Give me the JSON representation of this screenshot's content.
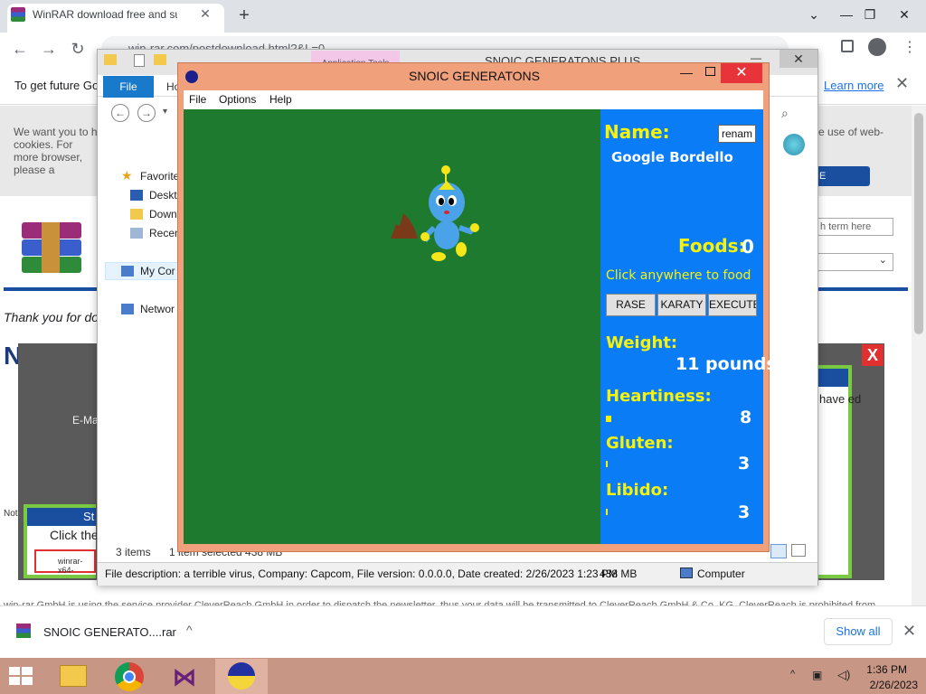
{
  "browser": {
    "tab_title": "WinRAR download free and supp",
    "tab_close": "✕",
    "new_tab": "+",
    "url": "win-rar.com/postdownload.html?&L=0",
    "controls": {
      "chevron": "⌄",
      "minimize": "—",
      "restore": "❐",
      "close": "✕"
    },
    "nav": {
      "back": "←",
      "forward": "→",
      "reload": "↻"
    },
    "infobar": {
      "text": "To get future Go",
      "help": "?",
      "learn_more": "Learn more",
      "close": "✕"
    }
  },
  "page": {
    "cookie_text": "We want you to h cookies. For more browser, please a",
    "cookie_right": "e use of web-",
    "cookie_button": "E",
    "search_placeholder": "h term here",
    "select_arrow": "⌄",
    "thanks": "Thank you for do",
    "heading": "Now ge",
    "email_label": "E-Ma",
    "overlay_close": "X",
    "popup_right_text": "have ed",
    "popup_left_header": "St",
    "popup_left_text": "Click the",
    "download_file": "winrar-x64-",
    "note": "Not",
    "footer": "win-rar GmbH is using the service provider CleverReach GmbH in order to dispatch the newsletter, thus your data will be transmitted to CleverReach GmbH & Co. KG. CleverReach is prohibited from"
  },
  "explorer": {
    "title": "SNOIC GENERATONS PLUS",
    "app_tools": "Application Tools",
    "minimize": "—",
    "close": "✕",
    "file_tab": "File",
    "home_tab": "Ho",
    "nav_back": "←",
    "nav_forward": "→",
    "nav_down": "▾",
    "search_icon": "⌕",
    "nav_items": [
      "Favorite",
      "Deskt",
      "Down",
      "Recen",
      "My Cor",
      "Networ"
    ],
    "status_items": "3 items",
    "status_selected": "1 item selected  438 MB",
    "details": "File description: a terrible virus, Company: Capcom, File version: 0.0.0.0, Date created: 2/26/2023 1:23 PM",
    "size": "438 MB",
    "computer": "Computer"
  },
  "game": {
    "title": "SNOIC GENERATONS",
    "controls": {
      "minimize": "—",
      "close": "✕"
    },
    "menu": [
      "File",
      "Options",
      "Help"
    ],
    "name_label": "Name:",
    "rename_button": "renam",
    "name_value": "Google Bordello",
    "foods_label": "Foods:",
    "foods_value": "0",
    "hint": "Click anywhere to food",
    "buttons": [
      "RASE",
      "KARATY",
      "EXECUTE"
    ],
    "weight_label": "Weight:",
    "weight_value": "11 pounds",
    "heartiness_label": "Heartiness:",
    "heartiness_value": "8",
    "gluten_label": "Gluten:",
    "gluten_value": "3",
    "libido_label": "Libido:",
    "libido_value": "3",
    "colors": {
      "playfield": "#1e7a2e",
      "panel": "#0a7cf5",
      "stat_text": "#f5f20c",
      "value_text": "#ffffff",
      "creature": "#4aa3e8",
      "poop": "#7a3a1a"
    }
  },
  "downloads": {
    "file_name": "SNOIC GENERATO....rar",
    "chevron": "^",
    "show_all": "Show all",
    "close": "✕"
  },
  "taskbar": {
    "time": "1:36 PM",
    "date": "2/26/2023",
    "tray_arrow": "^",
    "apps": [
      "file-explorer-icon",
      "chrome-icon",
      "visual-studio-icon",
      "snoic-game-icon"
    ]
  }
}
